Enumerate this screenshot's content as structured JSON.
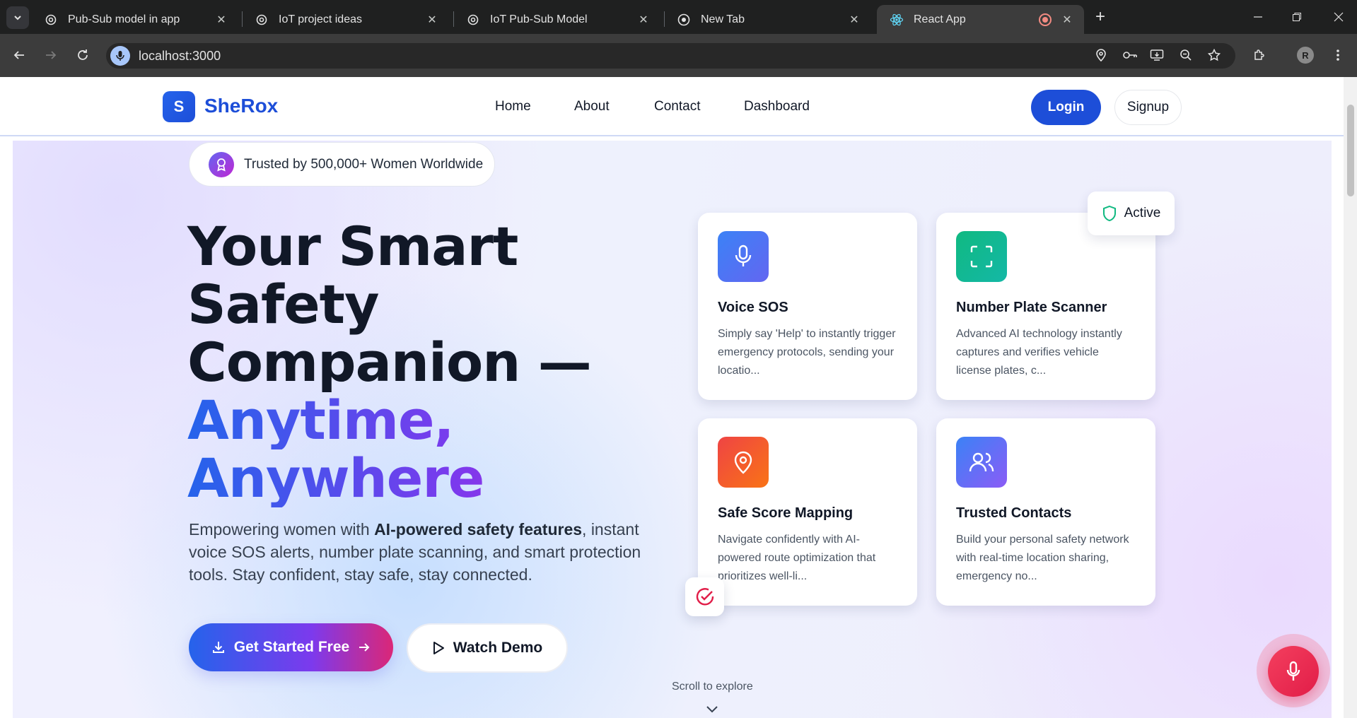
{
  "browser": {
    "tabs": [
      {
        "title": "Pub-Sub model in app",
        "icon": "openai-icon"
      },
      {
        "title": "IoT project ideas",
        "icon": "openai-icon"
      },
      {
        "title": "IoT Pub-Sub Model",
        "icon": "openai-icon"
      },
      {
        "title": "New Tab",
        "icon": "chrome-icon"
      },
      {
        "title": "React App",
        "icon": "react-icon",
        "active": true
      }
    ],
    "url": "localhost:3000",
    "profile_initial": "R"
  },
  "nav": {
    "logo_letter": "S",
    "brand": "SheRox",
    "links": [
      "Home",
      "About",
      "Contact",
      "Dashboard"
    ],
    "login": "Login",
    "signup": "Signup"
  },
  "hero": {
    "trust_badge": "Trusted by 500,000+ Women Worldwide",
    "headline_line1": "Your Smart",
    "headline_line2": "Safety",
    "headline_line3": "Companion —",
    "headline_grad1": "Anytime,",
    "headline_grad2": "Anywhere",
    "sub_prefix": "Empowering women with ",
    "sub_bold": "AI-powered safety features",
    "sub_suffix": ", instant voice SOS alerts, number plate scanning, and smart protection tools. Stay confident, stay safe, stay connected.",
    "cta_primary": "Get Started Free",
    "cta_secondary": "Watch Demo",
    "scroll_hint": "Scroll to explore"
  },
  "features": [
    {
      "title": "Voice SOS",
      "desc": "Simply say 'Help' to instantly trigger emergency protocols, sending your locatio...",
      "icon": "microphone-icon",
      "color": "#6366f1"
    },
    {
      "title": "Number Plate Scanner",
      "desc": "Advanced AI technology instantly captures and verifies vehicle license plates, c...",
      "icon": "scan-icon",
      "color": "#10b981"
    },
    {
      "title": "Safe Score Mapping",
      "desc": "Navigate confidently with AI-powered route optimization that prioritizes well-li...",
      "icon": "map-pin-icon",
      "color": "#ef4444"
    },
    {
      "title": "Trusted Contacts",
      "desc": "Build your personal safety network with real-time location sharing, emergency no...",
      "icon": "users-icon",
      "color": "#6366f1"
    }
  ],
  "status": {
    "active_label": "Active"
  },
  "colors": {
    "brand": "#1d4ed8",
    "accent_purple": "#7c3aed",
    "accent_pink": "#db2777",
    "sos_red": "#e11d48"
  }
}
